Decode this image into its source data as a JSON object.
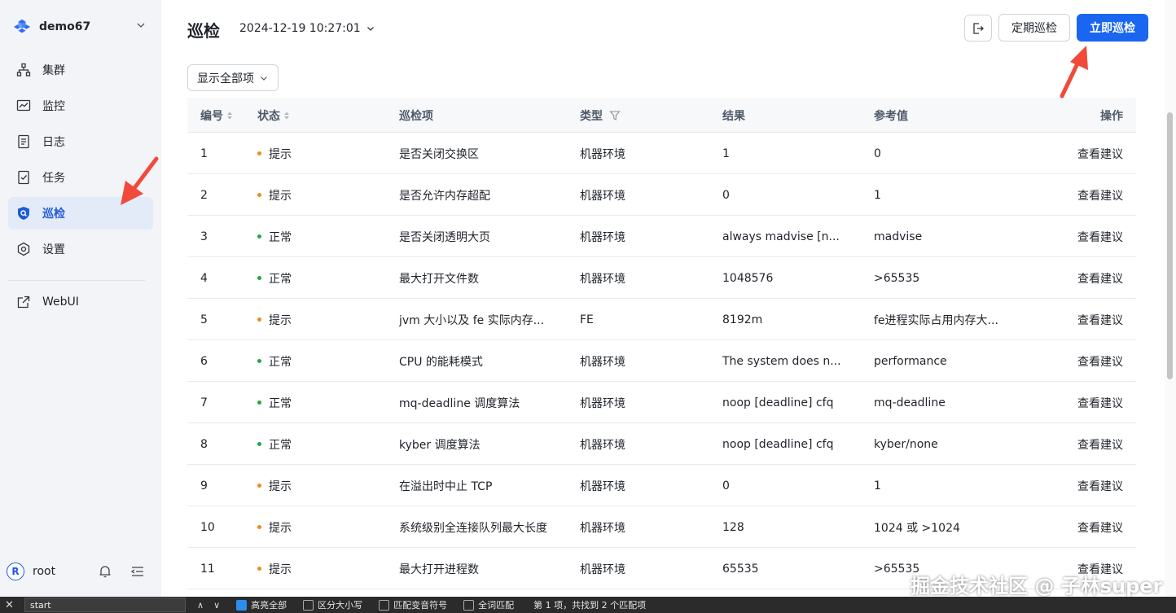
{
  "sidebar": {
    "cluster_name": "demo67",
    "items": [
      {
        "label": "集群",
        "icon": "cluster-icon"
      },
      {
        "label": "监控",
        "icon": "monitor-icon"
      },
      {
        "label": "日志",
        "icon": "log-icon"
      },
      {
        "label": "任务",
        "icon": "task-icon"
      },
      {
        "label": "巡检",
        "icon": "inspect-shield-icon",
        "active": true
      },
      {
        "label": "设置",
        "icon": "gear-icon"
      }
    ],
    "webui_label": "WebUI",
    "user": {
      "avatar_letter": "R",
      "name": "root"
    }
  },
  "header": {
    "title": "巡检",
    "date": "2024-12-19 10:27:01",
    "schedule_label": "定期巡检",
    "run_label": "立即巡检"
  },
  "filter_label": "显示全部项",
  "table": {
    "columns": [
      "编号",
      "状态",
      "巡检项",
      "类型",
      "结果",
      "参考值",
      "操作"
    ],
    "rows": [
      {
        "id": "1",
        "status": "提示",
        "level": "warn",
        "item": "是否关闭交换区",
        "type": "机器环境",
        "result": "1",
        "ref": "0",
        "action": "查看建议"
      },
      {
        "id": "2",
        "status": "提示",
        "level": "warn",
        "item": "是否允许内存超配",
        "type": "机器环境",
        "result": "0",
        "ref": "1",
        "action": "查看建议"
      },
      {
        "id": "3",
        "status": "正常",
        "level": "ok",
        "item": "是否关闭透明大页",
        "type": "机器环境",
        "result": "always madvise [n...",
        "ref": "madvise",
        "action": "查看建议"
      },
      {
        "id": "4",
        "status": "正常",
        "level": "ok",
        "item": "最大打开文件数",
        "type": "机器环境",
        "result": "1048576",
        "ref": ">65535",
        "action": "查看建议"
      },
      {
        "id": "5",
        "status": "提示",
        "level": "warn",
        "item": "jvm 大小以及 fe 实际内存...",
        "type": "FE",
        "result": "8192m",
        "ref": "fe进程实际占用内存大...",
        "action": "查看建议"
      },
      {
        "id": "6",
        "status": "正常",
        "level": "ok",
        "item": "CPU 的能耗模式",
        "type": "机器环境",
        "result": "The system does n...",
        "ref": "performance",
        "action": "查看建议"
      },
      {
        "id": "7",
        "status": "正常",
        "level": "ok",
        "item": "mq-deadline 调度算法",
        "type": "机器环境",
        "result": "noop [deadline] cfq",
        "ref": "mq-deadline",
        "action": "查看建议"
      },
      {
        "id": "8",
        "status": "正常",
        "level": "ok",
        "item": "kyber 调度算法",
        "type": "机器环境",
        "result": "noop [deadline] cfq",
        "ref": "kyber/none",
        "action": "查看建议"
      },
      {
        "id": "9",
        "status": "提示",
        "level": "warn",
        "item": "在溢出时中止 TCP",
        "type": "机器环境",
        "result": "0",
        "ref": "1",
        "action": "查看建议"
      },
      {
        "id": "10",
        "status": "提示",
        "level": "warn",
        "item": "系统级别全连接队列最大长度",
        "type": "机器环境",
        "result": "128",
        "ref": "1024 或 >1024",
        "action": "查看建议"
      },
      {
        "id": "11",
        "status": "提示",
        "level": "warn",
        "item": "最大打开进程数",
        "type": "机器环境",
        "result": "65535",
        "ref": ">65535",
        "action": "查看建议"
      }
    ]
  },
  "findbar": {
    "query": "start",
    "highlight_all": "高亮全部",
    "match_case": "区分大小写",
    "match_diacritics": "匹配变音符号",
    "whole_words": "全词匹配",
    "status": "第 1 项，共找到 2 个匹配项"
  },
  "watermark": "掘金技术社区 @ 子林super",
  "colors": {
    "accent": "#1a66f0",
    "ok": "#21a843",
    "warn": "#f08a1c",
    "sidebar_bg": "#f2f4f8",
    "annotation_arrow": "#f04a3a"
  }
}
